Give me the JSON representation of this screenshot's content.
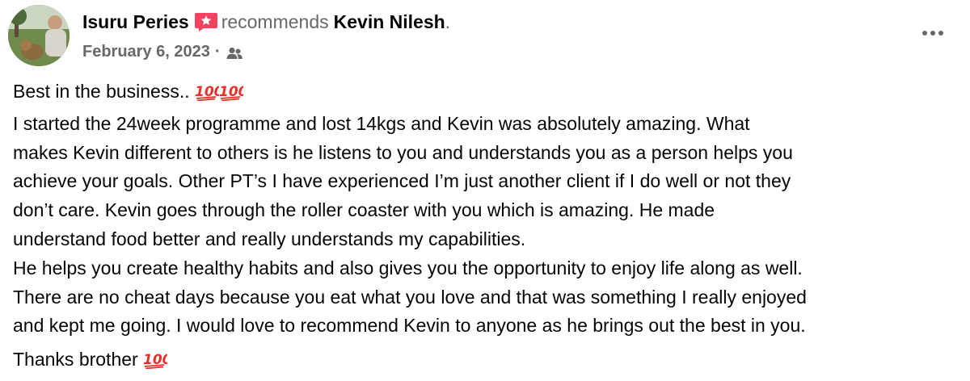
{
  "post": {
    "author": "Isuru Peries",
    "action": "recommends",
    "subject": "Kevin Nilesh",
    "trailing": ".",
    "date": "February 6, 2023",
    "separator": "·",
    "icons": {
      "badge": "recommendation-badge-icon",
      "audience": "friends-audience-icon",
      "more": "more-options-icon",
      "emoji": "hundred-points-emoji"
    },
    "colors": {
      "badge": "#f3425f",
      "emoji": "#e8302b",
      "secondary_text": "#65676b"
    },
    "lines": [
      "Best in the business..",
      "I started the 24week programme and lost 14kgs and Kevin was absolutely amazing. What",
      "makes Kevin different to others is he listens to you and understands you as a person helps you",
      "achieve your goals. Other PT’s I have experienced I’m just another client if I do well or not they",
      "don’t care. Kevin goes through the roller coaster with you which is amazing. He made",
      "understand food better and really understands my capabilities.",
      "He helps you create healthy habits and also gives you the opportunity to enjoy life along as well.",
      "There are no cheat days because you eat what you love and that was something I really enjoyed",
      "and kept me going. I would love to recommend Kevin to anyone as he brings out the best in you."
    ],
    "closing": "Thanks brother"
  }
}
